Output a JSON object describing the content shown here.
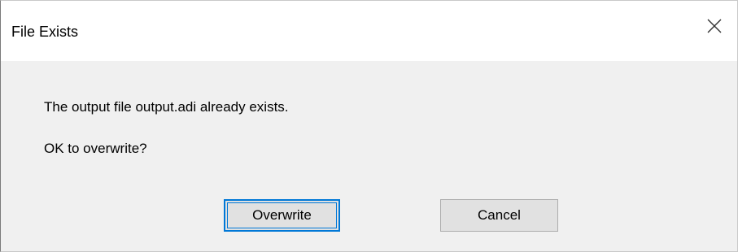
{
  "dialog": {
    "title": "File Exists",
    "close_icon": "close-icon",
    "message_line_1": "The output file output.adi already exists.",
    "message_line_2": "OK to overwrite?",
    "buttons": {
      "overwrite_label": "Overwrite",
      "cancel_label": "Cancel"
    },
    "colors": {
      "title_bar": "#ffffff",
      "body": "#f0f0f0",
      "default_button_border": "#0078d7",
      "button_face": "#e1e1e1"
    }
  }
}
